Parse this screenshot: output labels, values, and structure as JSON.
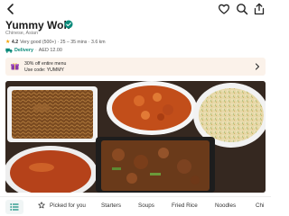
{
  "header": {
    "icons": [
      "back-arrow-icon",
      "heart-icon",
      "search-icon",
      "share-icon"
    ]
  },
  "restaurant": {
    "name": "Yummy Wok",
    "cuisine": "Chinese, Asian",
    "rating": "4.2",
    "rating_text": "Very good (500+)",
    "time": "25 – 35 mins",
    "distance": "3.6 km",
    "delivery_label": "Delivery",
    "delivery_fee": "AED 12.00"
  },
  "promo": {
    "line1": "30% off entire menu",
    "line2": "Use code: YUMMY"
  },
  "tabs": {
    "picked": "Picked for you",
    "starters": "Starters",
    "soups": "Soups",
    "fried_rice": "Fried Rice",
    "noodles": "Noodles",
    "partial": "Chi"
  },
  "colors": {
    "accent_teal": "#0a8a7a",
    "star": "#f2a200",
    "promo_bg": "#fbf2ea",
    "gift": "#8b3aa8"
  }
}
